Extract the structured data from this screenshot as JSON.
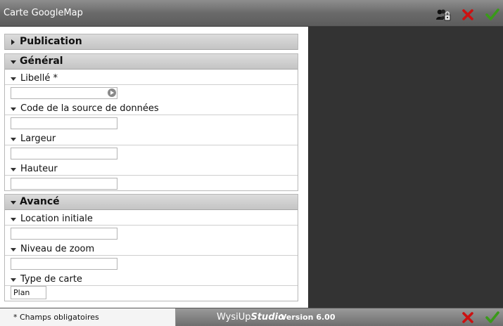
{
  "window": {
    "title": "Carte GoogleMap"
  },
  "sections": {
    "publication": {
      "label": "Publication"
    },
    "general": {
      "label": "Général",
      "fields": {
        "libelle": {
          "label": "Libellé *",
          "value": ""
        },
        "code_source": {
          "label": "Code de la source de données",
          "value": ""
        },
        "largeur": {
          "label": "Largeur",
          "value": ""
        },
        "hauteur": {
          "label": "Hauteur",
          "value": ""
        }
      }
    },
    "avance": {
      "label": "Avancé",
      "fields": {
        "location": {
          "label": "Location initiale",
          "value": ""
        },
        "zoom": {
          "label": "Niveau de zoom",
          "value": ""
        },
        "type_carte": {
          "label": "Type de carte",
          "value": "Plan"
        }
      }
    }
  },
  "footer": {
    "required_note": "* Champs obligatoires",
    "brand_a": "WysiUp",
    "brand_b": "Studio",
    "version": "Version 6.00"
  },
  "icons": {
    "users_lock": "users-lock-icon",
    "cancel": "close-icon",
    "validate": "checkmark-icon"
  },
  "colors": {
    "cancel": "#cc1111",
    "validate": "#3a9a1a",
    "preview_bg": "#333333"
  }
}
